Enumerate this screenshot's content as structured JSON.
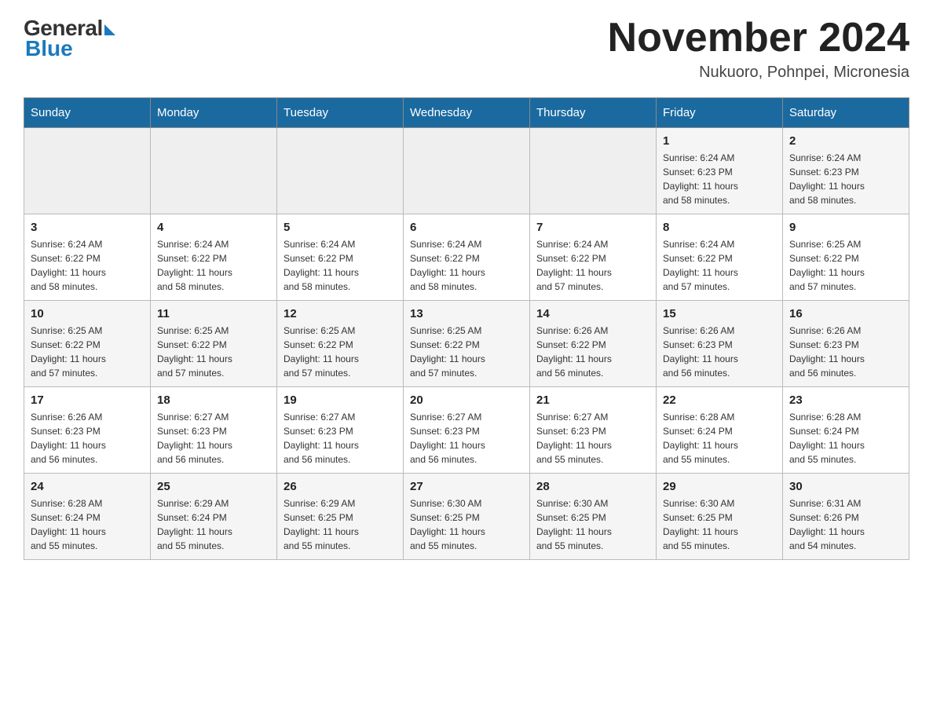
{
  "header": {
    "logo_general": "General",
    "logo_blue": "Blue",
    "month_title": "November 2024",
    "location": "Nukuoro, Pohnpei, Micronesia"
  },
  "days_of_week": [
    "Sunday",
    "Monday",
    "Tuesday",
    "Wednesday",
    "Thursday",
    "Friday",
    "Saturday"
  ],
  "weeks": [
    {
      "days": [
        {
          "num": "",
          "info": ""
        },
        {
          "num": "",
          "info": ""
        },
        {
          "num": "",
          "info": ""
        },
        {
          "num": "",
          "info": ""
        },
        {
          "num": "",
          "info": ""
        },
        {
          "num": "1",
          "info": "Sunrise: 6:24 AM\nSunset: 6:23 PM\nDaylight: 11 hours\nand 58 minutes."
        },
        {
          "num": "2",
          "info": "Sunrise: 6:24 AM\nSunset: 6:23 PM\nDaylight: 11 hours\nand 58 minutes."
        }
      ]
    },
    {
      "days": [
        {
          "num": "3",
          "info": "Sunrise: 6:24 AM\nSunset: 6:22 PM\nDaylight: 11 hours\nand 58 minutes."
        },
        {
          "num": "4",
          "info": "Sunrise: 6:24 AM\nSunset: 6:22 PM\nDaylight: 11 hours\nand 58 minutes."
        },
        {
          "num": "5",
          "info": "Sunrise: 6:24 AM\nSunset: 6:22 PM\nDaylight: 11 hours\nand 58 minutes."
        },
        {
          "num": "6",
          "info": "Sunrise: 6:24 AM\nSunset: 6:22 PM\nDaylight: 11 hours\nand 58 minutes."
        },
        {
          "num": "7",
          "info": "Sunrise: 6:24 AM\nSunset: 6:22 PM\nDaylight: 11 hours\nand 57 minutes."
        },
        {
          "num": "8",
          "info": "Sunrise: 6:24 AM\nSunset: 6:22 PM\nDaylight: 11 hours\nand 57 minutes."
        },
        {
          "num": "9",
          "info": "Sunrise: 6:25 AM\nSunset: 6:22 PM\nDaylight: 11 hours\nand 57 minutes."
        }
      ]
    },
    {
      "days": [
        {
          "num": "10",
          "info": "Sunrise: 6:25 AM\nSunset: 6:22 PM\nDaylight: 11 hours\nand 57 minutes."
        },
        {
          "num": "11",
          "info": "Sunrise: 6:25 AM\nSunset: 6:22 PM\nDaylight: 11 hours\nand 57 minutes."
        },
        {
          "num": "12",
          "info": "Sunrise: 6:25 AM\nSunset: 6:22 PM\nDaylight: 11 hours\nand 57 minutes."
        },
        {
          "num": "13",
          "info": "Sunrise: 6:25 AM\nSunset: 6:22 PM\nDaylight: 11 hours\nand 57 minutes."
        },
        {
          "num": "14",
          "info": "Sunrise: 6:26 AM\nSunset: 6:22 PM\nDaylight: 11 hours\nand 56 minutes."
        },
        {
          "num": "15",
          "info": "Sunrise: 6:26 AM\nSunset: 6:23 PM\nDaylight: 11 hours\nand 56 minutes."
        },
        {
          "num": "16",
          "info": "Sunrise: 6:26 AM\nSunset: 6:23 PM\nDaylight: 11 hours\nand 56 minutes."
        }
      ]
    },
    {
      "days": [
        {
          "num": "17",
          "info": "Sunrise: 6:26 AM\nSunset: 6:23 PM\nDaylight: 11 hours\nand 56 minutes."
        },
        {
          "num": "18",
          "info": "Sunrise: 6:27 AM\nSunset: 6:23 PM\nDaylight: 11 hours\nand 56 minutes."
        },
        {
          "num": "19",
          "info": "Sunrise: 6:27 AM\nSunset: 6:23 PM\nDaylight: 11 hours\nand 56 minutes."
        },
        {
          "num": "20",
          "info": "Sunrise: 6:27 AM\nSunset: 6:23 PM\nDaylight: 11 hours\nand 56 minutes."
        },
        {
          "num": "21",
          "info": "Sunrise: 6:27 AM\nSunset: 6:23 PM\nDaylight: 11 hours\nand 55 minutes."
        },
        {
          "num": "22",
          "info": "Sunrise: 6:28 AM\nSunset: 6:24 PM\nDaylight: 11 hours\nand 55 minutes."
        },
        {
          "num": "23",
          "info": "Sunrise: 6:28 AM\nSunset: 6:24 PM\nDaylight: 11 hours\nand 55 minutes."
        }
      ]
    },
    {
      "days": [
        {
          "num": "24",
          "info": "Sunrise: 6:28 AM\nSunset: 6:24 PM\nDaylight: 11 hours\nand 55 minutes."
        },
        {
          "num": "25",
          "info": "Sunrise: 6:29 AM\nSunset: 6:24 PM\nDaylight: 11 hours\nand 55 minutes."
        },
        {
          "num": "26",
          "info": "Sunrise: 6:29 AM\nSunset: 6:25 PM\nDaylight: 11 hours\nand 55 minutes."
        },
        {
          "num": "27",
          "info": "Sunrise: 6:30 AM\nSunset: 6:25 PM\nDaylight: 11 hours\nand 55 minutes."
        },
        {
          "num": "28",
          "info": "Sunrise: 6:30 AM\nSunset: 6:25 PM\nDaylight: 11 hours\nand 55 minutes."
        },
        {
          "num": "29",
          "info": "Sunrise: 6:30 AM\nSunset: 6:25 PM\nDaylight: 11 hours\nand 55 minutes."
        },
        {
          "num": "30",
          "info": "Sunrise: 6:31 AM\nSunset: 6:26 PM\nDaylight: 11 hours\nand 54 minutes."
        }
      ]
    }
  ]
}
